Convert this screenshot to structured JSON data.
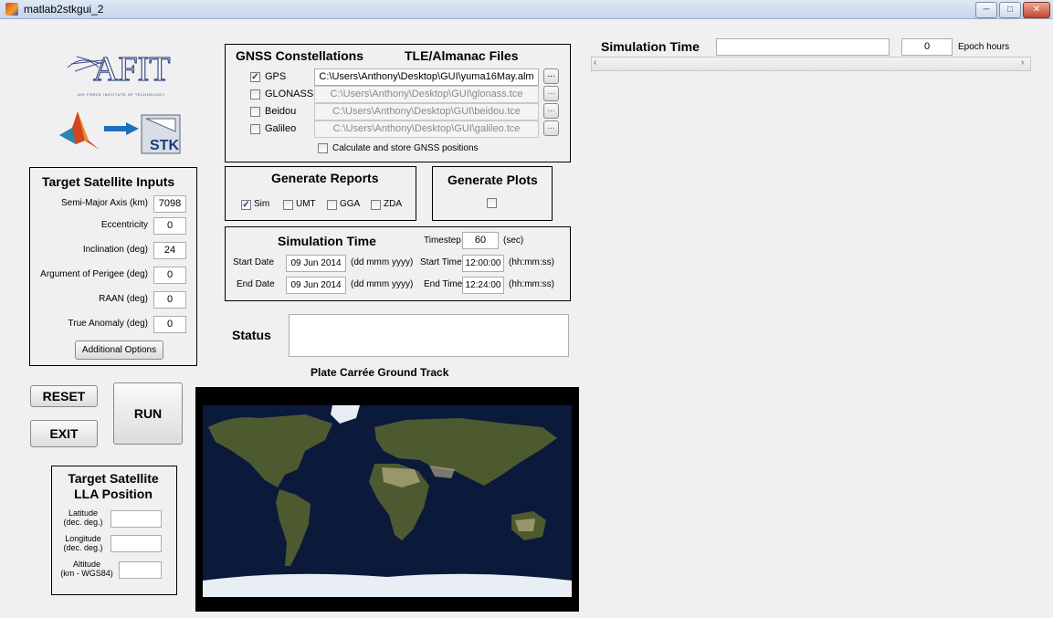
{
  "window": {
    "title": "matlab2stkgui_2",
    "min": "─",
    "max": "□",
    "close": "✕"
  },
  "logo": {
    "afit": "AFIT",
    "subtitle": "AIR FORCE INSTITUTE OF TECHNOLOGY",
    "stk": "STK"
  },
  "gnss": {
    "header": "GNSS Constellations",
    "files_header": "TLE/Almanac Files",
    "items": [
      {
        "label": "GPS",
        "checked": "✓",
        "file": "C:\\Users\\Anthony\\Desktop\\GUI\\yuma16May.alm"
      },
      {
        "label": "GLONASS",
        "checked": "",
        "file": "C:\\Users\\Anthony\\Desktop\\GUI\\glonass.tce"
      },
      {
        "label": "Beidou",
        "checked": "",
        "file": "C:\\Users\\Anthony\\Desktop\\GUI\\beidou.tce"
      },
      {
        "label": "Galileo",
        "checked": "",
        "file": "C:\\Users\\Anthony\\Desktop\\GUI\\galileo.tce"
      }
    ],
    "browse": "...",
    "calc_label": "Calculate and store GNSS positions"
  },
  "sim_top": {
    "label": "Simulation Time",
    "value": "0",
    "unit": "Epoch hours"
  },
  "target": {
    "header": "Target Satellite Inputs",
    "fields": [
      {
        "label": "Semi-Major Axis (km)",
        "value": "7098"
      },
      {
        "label": "Eccentricity",
        "value": "0"
      },
      {
        "label": "Inclination (deg)",
        "value": "24"
      },
      {
        "label": "Argument of Perigee (deg)",
        "value": "0"
      },
      {
        "label": "RAAN (deg)",
        "value": "0"
      },
      {
        "label": "True Anomaly (deg)",
        "value": "0"
      }
    ],
    "options_button": "Additional Options"
  },
  "reports": {
    "header": "Generate Reports",
    "items": [
      {
        "label": "Sim",
        "checked": "✓"
      },
      {
        "label": "UMT",
        "checked": ""
      },
      {
        "label": "GGA",
        "checked": ""
      },
      {
        "label": "ZDA",
        "checked": ""
      }
    ]
  },
  "plots": {
    "header": "Generate Plots",
    "checked": ""
  },
  "simtime": {
    "header": "Simulation Time",
    "timestep_label": "Timestep",
    "timestep": "60",
    "timestep_unit": "(sec)",
    "start_date_label": "Start Date",
    "start_date": "09 Jun 2014",
    "date_fmt": "(dd mmm yyyy)",
    "start_time_label": "Start Time",
    "start_time": "12:00:00",
    "time_fmt": "(hh:mm:ss)",
    "end_date_label": "End Date",
    "end_date": "09 Jun 2014",
    "end_time_label": "End Time",
    "end_time": "12:24:00"
  },
  "status": {
    "label": "Status",
    "value": ""
  },
  "groundtrack": {
    "title": "Plate Carrée Ground Track"
  },
  "buttons": {
    "reset": "RESET",
    "exit": "EXIT",
    "run": "RUN"
  },
  "lla": {
    "header_line1": "Target Satellite",
    "header_line2": "LLA Position",
    "lat1": "Latitude",
    "lat2": "(dec. deg.)",
    "lon1": "Longitude",
    "lon2": "(dec. deg.)",
    "alt1": "Altitude",
    "alt2": "(km - WGS84)"
  }
}
